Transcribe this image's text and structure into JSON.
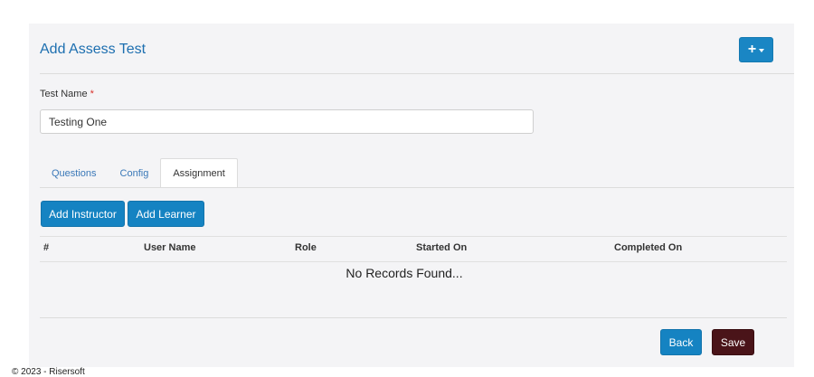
{
  "page": {
    "title": "Add Assess Test",
    "add_menu": {
      "icon": "plus-icon",
      "caret": "caret-down-icon"
    }
  },
  "form": {
    "test_name_label": "Test Name",
    "required_marker": "*",
    "test_name_value": "Testing One"
  },
  "tabs": [
    {
      "label": "Questions",
      "active": false
    },
    {
      "label": "Config",
      "active": false
    },
    {
      "label": "Assignment",
      "active": true
    }
  ],
  "assignment": {
    "add_instructor_label": "Add Instructor",
    "add_learner_label": "Add Learner",
    "columns": [
      "#",
      "User Name",
      "Role",
      "Started On",
      "Completed On"
    ],
    "rows": [],
    "empty_message": "No Records Found..."
  },
  "actions": {
    "back_label": "Back",
    "save_label": "Save"
  },
  "footer": {
    "text": "© 2023 - Risersoft"
  },
  "colors": {
    "primary": "#1583c2",
    "save": "#4a1419",
    "title": "#1d6fb0",
    "required": "#d9312b",
    "tab_link": "#3a78b8"
  }
}
